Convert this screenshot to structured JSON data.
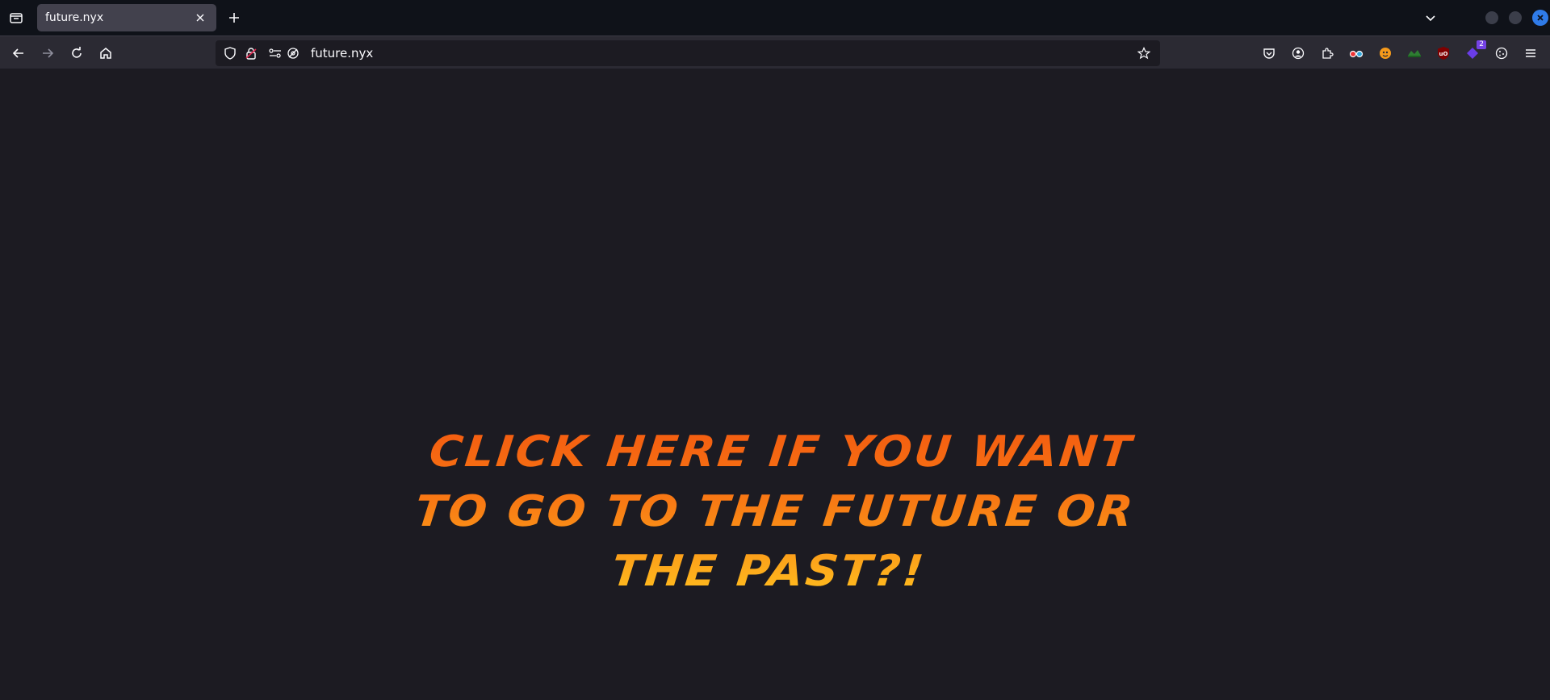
{
  "tab": {
    "title": "future.nyx"
  },
  "urlbar": {
    "url": "future.nyx"
  },
  "extensions": {
    "badge_count": "2"
  },
  "content": {
    "cta_text": "Click here if you want to go to the future or the past?!"
  },
  "colors": {
    "tabstrip_bg": "#0f1219",
    "navbar_bg": "#2b2a33",
    "page_bg": "#1c1b22",
    "text_gradient_top": "#f35a10",
    "text_gradient_bottom": "#ffc21f",
    "close_button": "#2f7be8"
  },
  "icons": [
    "tab-list-icon",
    "close-icon",
    "plus-icon",
    "chevron-down-icon",
    "back-arrow-icon",
    "forward-arrow-icon",
    "reload-icon",
    "home-icon",
    "shield-icon",
    "lock-warning-icon",
    "permissions-icon",
    "tracking-off-icon",
    "star-icon",
    "pocket-icon",
    "account-icon",
    "extensions-icon",
    "glasses-icon",
    "orange-ext-icon",
    "green-ext-icon",
    "ublock-icon",
    "purple-ext-icon",
    "cookie-icon",
    "menu-icon"
  ]
}
